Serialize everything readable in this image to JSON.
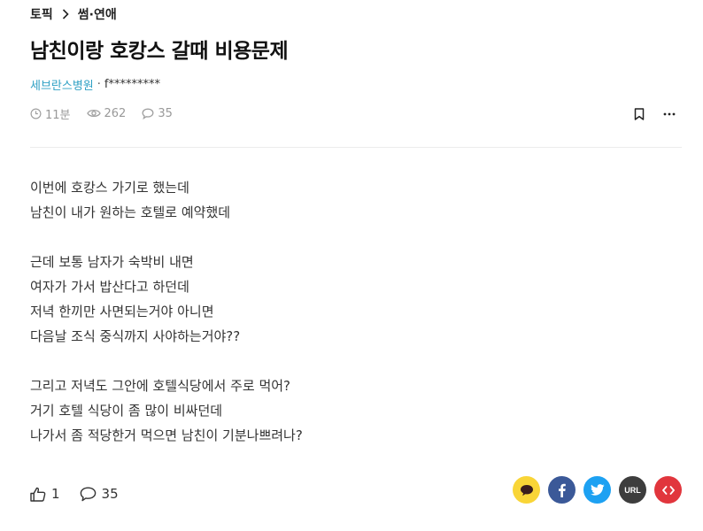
{
  "breadcrumb": {
    "root": "토픽",
    "current": "썸·연애"
  },
  "post": {
    "title": "남친이랑 호캉스 갈때 비용문제",
    "author_company": "세브란스병원",
    "author_separator": "·",
    "author_nick": "f*********",
    "time_ago": "11분",
    "views": "262",
    "comments": "35"
  },
  "content": {
    "lines": [
      "이번에 호캉스 가기로 했는데",
      "남친이 내가 원하는 호텔로 예약했데",
      "",
      "근데 보통 남자가 숙박비 내면",
      "여자가 가서 밥산다고 하던데",
      "저녁 한끼만 사면되는거야 아니면",
      "다음날 조식 중식까지 사야하는거야??",
      "",
      "그리고 저녁도 그안에 호텔식당에서 주로 먹어?",
      "거기 호텔 식당이 좀 많이 비싸던데",
      "나가서 좀 적당한거 먹으면 남친이 기분나쁘려나?"
    ]
  },
  "footer": {
    "likes": "1",
    "comments": "35",
    "url_label": "URL"
  },
  "icons": {
    "time": "clock-icon",
    "views": "eye-icon",
    "comments": "speech-bubble-icon",
    "bookmark": "bookmark-icon",
    "more": "more-horizontal-icon",
    "like": "thumbs-up-icon",
    "share_kakao": "kakao-icon",
    "share_facebook": "facebook-icon",
    "share_twitter": "twitter-icon",
    "share_url": "url-icon",
    "share_embed": "code-icon"
  },
  "colors": {
    "company_link": "#2ea0c4",
    "kakao": "#f9d537",
    "facebook": "#3b5998",
    "twitter": "#1da1f2",
    "url": "#3d3d3d",
    "embed": "#e1363d"
  }
}
